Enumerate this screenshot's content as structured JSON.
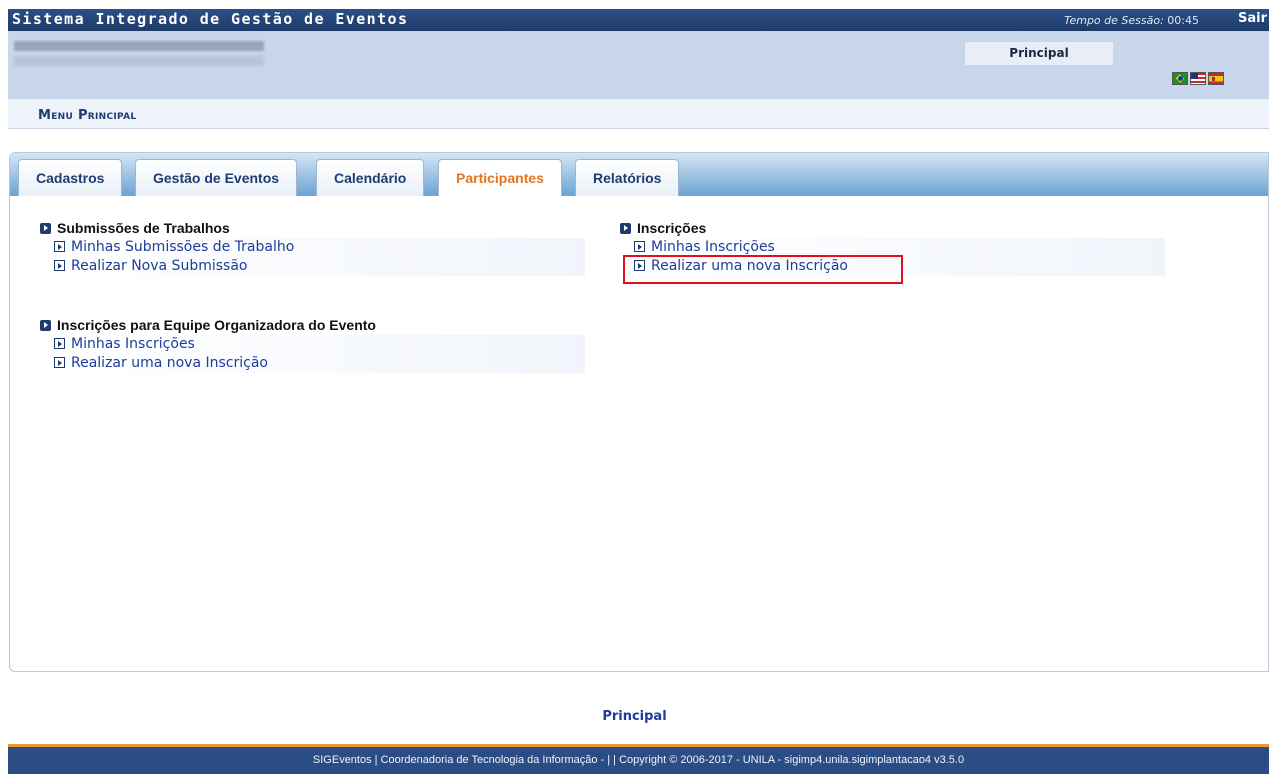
{
  "header": {
    "system_title": "Sistema Integrado de Gestão de Eventos",
    "session_label": "Tempo de Sessão:",
    "session_time": "00:45",
    "logout_label": "Sair"
  },
  "info": {
    "principal_label": "Principal",
    "flags": [
      "brazil-flag-icon",
      "usa-flag-icon",
      "spain-flag-icon"
    ]
  },
  "menu": {
    "title": "Menu Principal"
  },
  "tabs": [
    {
      "label": "Cadastros",
      "active": false
    },
    {
      "label": "Gestão de Eventos",
      "active": false
    },
    {
      "label": "Calendário",
      "active": false
    },
    {
      "label": "Participantes",
      "active": true
    },
    {
      "label": "Relatórios",
      "active": false
    }
  ],
  "sections": {
    "submissoes": {
      "title": "Submissões de Trabalhos",
      "links": [
        "Minhas Submissões de Trabalho",
        "Realizar Nova Submissão"
      ]
    },
    "inscricoes": {
      "title": "Inscrições",
      "links": [
        "Minhas Inscrições",
        "Realizar uma nova Inscrição"
      ]
    },
    "equipe": {
      "title": "Inscrições para Equipe Organizadora do Evento",
      "links": [
        "Minhas Inscrições",
        "Realizar uma nova Inscrição"
      ]
    }
  },
  "footer": {
    "principal_link": "Principal",
    "copyright": "SIGEventos | Coordenadoria de Tecnologia da Informação - | | Copyright © 2006-2017 - UNILA - sigimp4.unila.sigimplantacao4 v3.5.0"
  },
  "colors": {
    "header_bg": "#1d3a68",
    "active_tab": "#e8741b",
    "link": "#1e3c9a",
    "highlight": "#e0101e",
    "footer_accent": "#e8982e"
  }
}
